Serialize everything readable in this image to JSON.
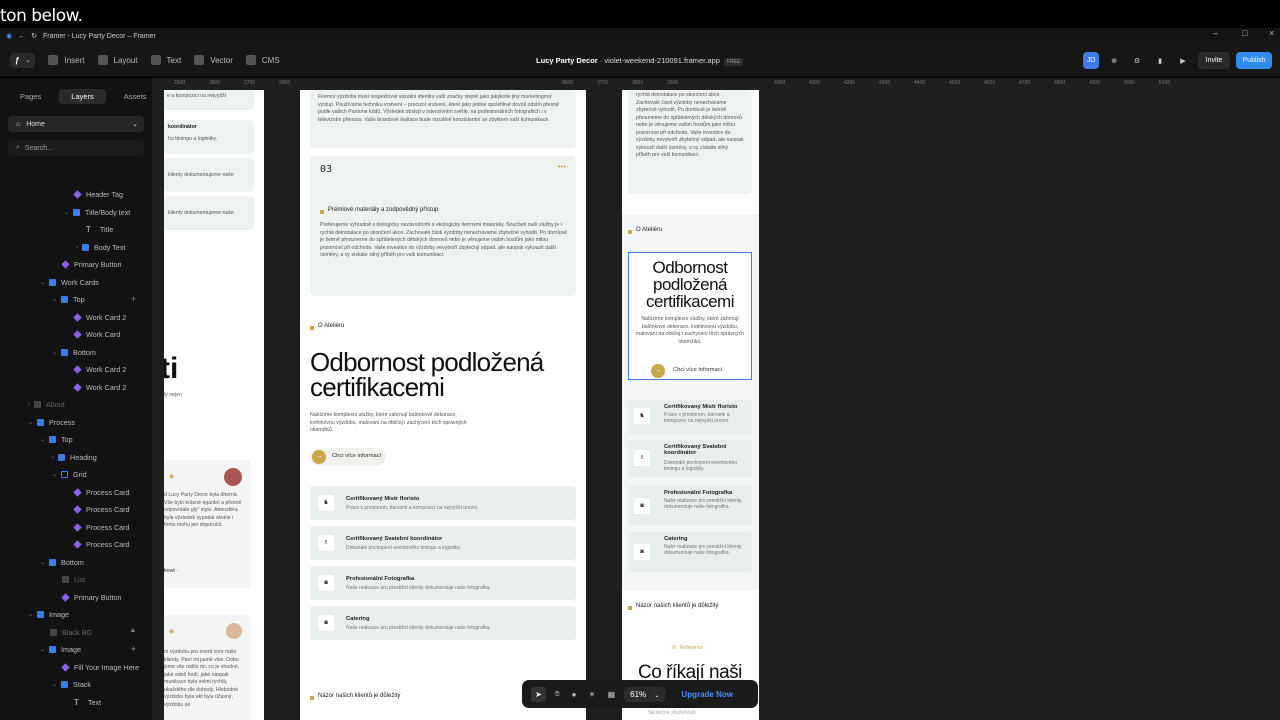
{
  "caption": "ton below.",
  "window": {
    "title": "Framer - Lucy Party Decor – Framer",
    "ctrls": [
      "–",
      "□",
      "×"
    ]
  },
  "toolbar": {
    "insert": "Insert",
    "layout": "Layout",
    "text": "Text",
    "vector": "Vector",
    "cms": "CMS",
    "project": "Lucy Party Decor",
    "domain": "· violet-weekend-210091.framer.app",
    "free": "FREE",
    "avatar": "JD",
    "invite": "Invite",
    "publish": "Publish"
  },
  "sidebar": {
    "tabs": [
      "Pages",
      "Layers",
      "Assets"
    ],
    "page": "Home",
    "search": "Search...",
    "layers": [
      "Header Tag",
      "Title/Body text",
      "Title",
      "Body Text",
      "Primary Button",
      "Work Cards",
      "Top",
      "Work Card 2",
      "Work Card",
      "Bottom",
      "Work Card 2",
      "Work Card 2",
      "About",
      "Process",
      "Top",
      "Heading",
      "Grid",
      "Process Card",
      "Process Card",
      "Process Card",
      "Process Card",
      "Bottom",
      "List",
      "Primary Button",
      "Image",
      "Black BG",
      "Image",
      "Fill Your Image Here",
      "Stack",
      "Text"
    ]
  },
  "ruler": [
    "2500",
    "2600",
    "2700",
    "2800",
    "3600",
    "3700",
    "3800",
    "3900",
    "4000",
    "4100",
    "4200",
    "4300",
    "4400",
    "4500",
    "4600",
    "4700",
    "4800",
    "4900",
    "5000",
    "5100"
  ],
  "frame_left": {
    "big": "ti",
    "sub": "ly nejen",
    "review1": "d Lucy Party Decor byla dherná. Vše bylo krásné egantní a přesně odpovídalo gly\" stylu. Atmosféra byla výsledek vypadal skvěle i firmu mohu jen doporučit.",
    "review1b": "kové ·",
    "review2": "m výzdobu pro event vore naše klienty. Paní mi jasně vlas. Dobu jsme vše rodilo mi, co je vhodné, jaké sobě hodí, jaké naopak munikace byla velmi rychlá, ukaždého dle dohody. Hlobodné výzdobu byla ekt byla úžasný, výzdobu se",
    "card1": "e a kompozici na nejvyšší",
    "card2t": "koordinátor",
    "card2d": "ho timingu a logistiky.",
    "card3d": "klienty dokumentujeme naše",
    "card4d": "klienty dokumentujeme naše"
  },
  "frame_mid": {
    "top_text": "Firemní výzdoba musí respektovat vizuální identitu vaší značky stejně jako jakýkoliv jiný marketingový výstup. Používáme techniku vrstvení – precizní vrstvení, které jako jediné spolehlivě dovolí odstín přesně podle vašich Pantone kódů. Výsledek obstojí v intenzivním světle, na profesionálních fotografiích i v televizním přenosu. Vaše brandové insitace bude vizuálně konzistentní se zbytkem vaší komunikace.",
    "num": "03",
    "dots": "•••",
    "card_title": "Prémiové materiály a zodpovědný přístup",
    "card_text": "Preferujeme výhradně s biologicky nezávodními a ekologicky šetrnými materiály. Součástí naší služby je i rychlá deinstalace po skončení akce. Zachovalé části výzdoby nenechávame zbytečně vyhodit. Po domluvě je šetrně přesunerne do spřátelených dětských domovů nebo je věnujeme vašim hostům jako milou pozornost při odchodu. Vaše investice do výzdoby nevytvoří zbytečný odpad, ale naopak vykouzlí další úsměvy, a vy získáte silný příběh pro vaši komunikaci.",
    "tag": "O Ateliéru",
    "heading": "Odbornost podložená certifikacemi",
    "lead": "Nabízíme komplexní služby, které zahrnují balónkové dekorace, květinovou výzdobu, malování na obličej i zachycení těch správných okamžiků.",
    "btn": "Chci více informací",
    "services": [
      {
        "icon": "♞",
        "title": "Certifikovaný Mistr floristo",
        "desc": "Práce s prostorem, barvami a kompozicí na nejvyšší úrovni."
      },
      {
        "icon": "♗",
        "title": "Certifikovaný Svatební koordinátor",
        "desc": "Dokonalé pochopení eventového timingu a logistiky."
      },
      {
        "icon": "◙",
        "title": "Profesionální Fotografka",
        "desc": "Naše realizace pro prestižní klienty dokumentuje naše fotografka."
      },
      {
        "icon": "◙",
        "title": "Catering",
        "desc": "Naše realizace pro prestižní klienty dokumentuje naše fotografka."
      }
    ],
    "bottom_tag": "Názor našich klientů je důležitý"
  },
  "frame_right": {
    "top_text": "rychlá deinstalace po skončení akce. Zachovalé části výzdoby nenechávame zbytečně vyhodit. Po domluvě je šetrně přesuneme do spřátelených dětských domovů nebo je věnujeme vašim hostům jako milou pozornost při odchodu. Vaše investice do výzdoby nevytvoří zbytečný odpad, ale naopak vykouzlí další úsměvy, a vy získáte silný příběh pro vaši komunikaci.",
    "tag": "O Ateliéru",
    "heading": "Odbornost podložená certifikacemi",
    "lead": "Nabízíme komplexní služby, které zahrnují balónkové dekorace, květinovou výzdobu, malování na obličej i zachycení těch správných okamžiků.",
    "btn": "Chci více informací",
    "services": [
      {
        "icon": "♞",
        "title": "Certifikovaný Mistr floristo",
        "desc": "Práce s prostorem, barvami a kompozicí na nejvyšší úrovni."
      },
      {
        "icon": "♗",
        "title": "Certifikovaný Svatební koordinátor",
        "desc": "Dokonalé pochopení eventového timingu a logistiky."
      },
      {
        "icon": "◙",
        "title": "Profesionální Fotografka",
        "desc": "Naše realizace pro prestižní klienty dokumentuje naše fotografka."
      },
      {
        "icon": "◙",
        "title": "Catering",
        "desc": "Naše realizace pro prestižní klienty dokumentuje naše fotografka."
      }
    ],
    "bottom_tag": "Názor našich klientů je důležitý",
    "ref": "Reference",
    "big": "Co říkají naši",
    "fade": "Skutečné zkušenosti"
  },
  "zoom": {
    "level": "61%",
    "upgrade": "Upgrade Now"
  },
  "colors": {
    "accent": "#c9a84b",
    "blue": "#3d7be8",
    "publish": "#2f8cf0"
  }
}
